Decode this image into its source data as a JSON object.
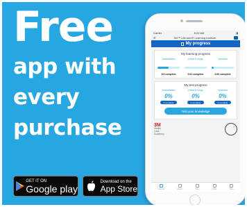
{
  "banner": {
    "background": "#27a7e2",
    "headline_big": "Free",
    "headline_lines": [
      "app with",
      "every",
      "purchase"
    ]
  },
  "stores": {
    "google": {
      "line1": "GET IT ON",
      "line2": "Google play",
      "icon": "play-icon"
    },
    "apple": {
      "line1": "Download on the",
      "line2": "App Store",
      "icon": "apple-icon"
    }
  },
  "phone": {
    "status": {
      "carrier": "Carrier",
      "time": "8:20 AM"
    },
    "app_header": "3M™ Littmann® Learning Institute",
    "page_title": "My progress",
    "learning": {
      "title": "My learning progress",
      "columns": [
        {
          "label": "Auscultation",
          "count": "2/4 complete",
          "progress": 0.5
        },
        {
          "label": "Heart & lungs",
          "count": "0/11 complete",
          "progress": 0.0
        },
        {
          "label": "Volumes",
          "count": "2/20 complete",
          "progress": 0.1
        }
      ]
    },
    "test": {
      "title": "My test progress",
      "columns": [
        {
          "label": "Auscultation",
          "pct": "0%",
          "pill": "0 complete"
        },
        {
          "label": "Heart & lungs",
          "pct": "0%",
          "pill": "0 complete"
        },
        {
          "label": "Volumes",
          "pct": "0%",
          "pill": "0 complete"
        }
      ],
      "button": "Test your knowledge"
    },
    "footer": {
      "logo": "3M",
      "lines": [
        "Health",
        "Care",
        "Academy"
      ]
    },
    "tabs": [
      "Learning",
      "Library",
      "Tests",
      "Profile",
      "More"
    ]
  }
}
